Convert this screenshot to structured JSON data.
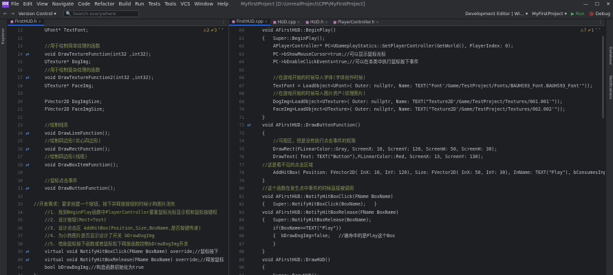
{
  "titlebar": {
    "logo": "IDE",
    "menu": [
      "File",
      "Edit",
      "View",
      "Navigate",
      "Code",
      "Refactor",
      "Build",
      "Run",
      "Tests",
      "Tools",
      "VCS",
      "Window",
      "Help"
    ],
    "path": "MyFirstProject [D:\\UnrealProject\\CPP\\MyFirstProject]",
    "win_min": "—",
    "win_max": "☐",
    "win_close": "✕"
  },
  "toolbar": {
    "back": "←",
    "fwd": "→",
    "version_control": "Version Control ▾",
    "search_placeholder": "🔍 Search everywhere",
    "config": "Development Editor | Wi... ▾",
    "project": "MyFirstProject ▾",
    "run": "▶ Run",
    "debug": "🐞 Debug"
  },
  "side": {
    "explorer": "Explorer",
    "database": "Database",
    "notifications": "Notifications"
  },
  "left": {
    "tabs": [
      {
        "label": "FirstHUD.h",
        "active": true
      }
    ],
    "inspect": "⚠2 ✔3 ˄ ˅",
    "lines": [
      {
        "ln": "11",
        "g": "",
        "t": "    UFont* TextFont;"
      },
      {
        "ln": "12",
        "g": "",
        "t": ""
      },
      {
        "ln": "13",
        "g": "",
        "t": "    //用于绘制简单纹理的函数"
      },
      {
        "ln": "14",
        "g": "⇄",
        "t": "    void DrawTextureFunction(int32 ,int32);"
      },
      {
        "ln": "15",
        "g": "",
        "t": "    UTexture* DogImg;"
      },
      {
        "ln": "16",
        "g": "",
        "t": "    //用于绘制复杂纹理的函数"
      },
      {
        "ln": "17",
        "g": "⇄",
        "t": "    void DrawTextureFunction2(int32 ,int32);"
      },
      {
        "ln": "18",
        "g": "",
        "t": "    UTexture* FaceImg;"
      },
      {
        "ln": "19",
        "g": "",
        "t": ""
      },
      {
        "ln": "20",
        "g": "",
        "t": "    FVector2D DogImgSize;"
      },
      {
        "ln": "21",
        "g": "",
        "t": "    FVector2D FaceImgSize;"
      },
      {
        "ln": "22",
        "g": "",
        "t": ""
      },
      {
        "ln": "23",
        "g": "",
        "t": "    //绘制线条"
      },
      {
        "ln": "24",
        "g": "⇄",
        "t": "    void DrawLineFunction();"
      },
      {
        "ln": "25",
        "g": "",
        "t": "    //绘制四边形(实心四边形)"
      },
      {
        "ln": "26",
        "g": "⇄",
        "t": "    void DrawRectFunction();"
      },
      {
        "ln": "27",
        "g": "",
        "t": "    //绘制四边形(线框)"
      },
      {
        "ln": "28",
        "g": "⇄",
        "t": "    void DrawBoxItemFunction();"
      },
      {
        "ln": "29",
        "g": "",
        "t": ""
      },
      {
        "ln": "30",
        "g": "",
        "t": "    //鼠标点击事件"
      },
      {
        "ln": "31",
        "g": "⇄",
        "t": "    void DrawButtonFunction();"
      },
      {
        "ln": "32",
        "g": "",
        "t": ""
      },
      {
        "ln": "33",
        "g": "",
        "t": "//开发需求：要求创建一个按钮，按下并释放按钮的时候小狗图片消失"
      },
      {
        "ln": "34",
        "g": "",
        "t": "    //1. 找到BeginPlay函数中PlayerController要重鼠标光标显示权和鼠标按键权"
      },
      {
        "ln": "35",
        "g": "",
        "t": "    //2. 设计按钮(Rect+Text)"
      },
      {
        "ln": "36",
        "g": "",
        "t": "    //3. 设计点击区 AddHitBox(Position,Size,BoxName,是否按键传递)"
      },
      {
        "ln": "37",
        "g": "",
        "t": "    //4. 为小狗图片是否显示设计了开关 bDrawDogImg"
      },
      {
        "ln": "38",
        "g": "",
        "t": "    //5. 借助鼠标按下函数或者鼠标松下释放函数控制bDrawDogImg开关"
      },
      {
        "ln": "39",
        "g": "⇄",
        "t": "    virtual void NotifyHitBoxClick(FName BoxName) override;//鼠标按下"
      },
      {
        "ln": "40",
        "g": "⇄",
        "t": "    virtual void NotifyHitBoxRelease(FName BoxName) override;//释放鼠标"
      },
      {
        "ln": "41",
        "g": "",
        "t": "    bool bDrawDogImg;//构造函数初始化为true"
      },
      {
        "ln": "42",
        "g": "",
        "t": "};"
      }
    ]
  },
  "right": {
    "tabs": [
      {
        "label": "FirstHUD.cpp",
        "active": true
      },
      {
        "label": "HUD.cpp",
        "active": false
      },
      {
        "label": "HUD.h",
        "active": false
      },
      {
        "label": "PlayerController.h",
        "active": false
      }
    ],
    "inspect": "⚠7 ✔1 ˄ ˅",
    "lines": [
      {
        "ln": "60",
        "g": "",
        "t": "void AFirstHUD::BeginPlay()"
      },
      {
        "ln": "61",
        "g": "",
        "t": "{   Super::BeginPlay();"
      },
      {
        "ln": "62",
        "g": "",
        "t": "    APlayerController* PC=UGameplayStatics::GetPlayerController(GetWorld(), PlayerIndex: 0);"
      },
      {
        "ln": "63",
        "g": "",
        "t": "    PC->bShowMouseCursor=true;//可以显示鼠标光标"
      },
      {
        "ln": "64",
        "g": "",
        "t": "    PC->bEnableClickEvents=true;//可以在本类中执行鼠标按下事件"
      },
      {
        "ln": "65",
        "g": "",
        "t": ""
      },
      {
        "ln": "66",
        "g": "",
        "t": "    //在游戏开始的时候导入字体(字体创作时候)"
      },
      {
        "ln": "67",
        "g": "",
        "t": "    TextFont = LoadObject<UFont>( Outer: nullptr, Name: TEXT(\"Font'/Game/TestProject/Fonts/BAUHS93_Font.BAUHS93_Font'\"));"
      },
      {
        "ln": "68",
        "g": "",
        "t": "    //在游戏开始的时候导入图片资产(纹理图片)"
      },
      {
        "ln": "69",
        "g": "",
        "t": "    DogImg=LoadObject<UTexture>( Outer: nullptr, Name: TEXT(\"Texture2D'/Game/TestProject/Textures/001.001'\"));"
      },
      {
        "ln": "70",
        "g": "",
        "t": "    FaceImg=LoadObject<UTexture>( Outer: nullptr, Name: TEXT(\"Texture2D'/Game/TestProject/Textures/002.002'\"));"
      },
      {
        "ln": "71",
        "g": "",
        "t": "}"
      },
      {
        "ln": "72",
        "g": "⇄",
        "t": "void AFirstHUD::DrawButtonFunction()"
      },
      {
        "ln": "73",
        "g": "",
        "t": "{"
      },
      {
        "ln": "74",
        "g": "",
        "t": "    //可视区，但是没有执行点击事件的权限"
      },
      {
        "ln": "75",
        "g": "",
        "t": "    DrawRect(FLinearColor::Gray, ScreenX: 10, ScreenY: 120, ScreenW: 50, ScreenH: 30);"
      },
      {
        "ln": "76",
        "g": "",
        "t": "    DrawText( Text: TEXT(\"Button\"),FLinearColor::Red, ScreenX: 13, ScreenY: 130);"
      },
      {
        "ln": "77",
        "g": "",
        "t": "//这是看不见的点击区域"
      },
      {
        "ln": "78",
        "g": "",
        "t": "    AddHitBox( Position: FVector2D( InX: 10, InY: 120), Size: FVector2D( InX: 50, InY: 30), InName: TEXT(\"Play\"), bConsumesInput: true);"
      },
      {
        "ln": "79",
        "g": "",
        "t": "}"
      },
      {
        "ln": "80",
        "g": "",
        "t": "//这个函数在发生点中事件的时候直接被调用"
      },
      {
        "ln": "81",
        "g": "",
        "t": "void AFirstHUD::NotifyHitBoxClick(FName BoxName)"
      },
      {
        "ln": "82",
        "g": "",
        "t": "{   Super::NotifyHitBoxClick(BoxName);   }"
      },
      {
        "ln": "83",
        "g": "",
        "t": "void AFirstHUD::NotifyHitBoxRelease(FName BoxName)"
      },
      {
        "ln": "84",
        "g": "",
        "t": "{   Super::NotifyHitBoxRelease(BoxName);"
      },
      {
        "ln": "85",
        "g": "",
        "t": "    if(BoxName==TEXT(\"Play\"))"
      },
      {
        "ln": "86",
        "g": "",
        "t": "    {  bDrawDogImg=false;   //被命中的是Play这个Box"
      },
      {
        "ln": "87",
        "g": "",
        "t": "    }"
      },
      {
        "ln": "88",
        "g": "",
        "t": "}"
      },
      {
        "ln": "89",
        "g": "",
        "t": "void AFirstHUD::DrawHUD()"
      },
      {
        "ln": "90",
        "g": "",
        "t": "{"
      },
      {
        "ln": "91",
        "g": "",
        "t": "    Super::DrawHUD();"
      },
      {
        "ln": "92",
        "g": "",
        "t": "    // DrawTextFunction();"
      }
    ]
  }
}
